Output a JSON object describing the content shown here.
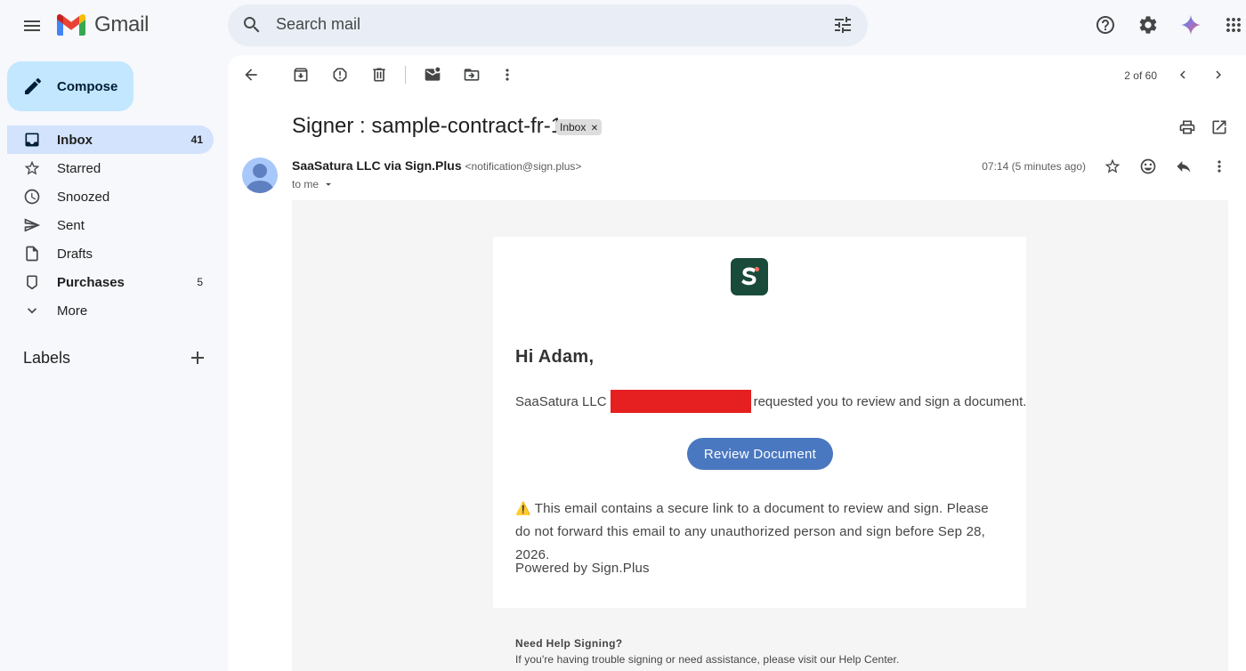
{
  "app": {
    "name": "Gmail"
  },
  "search": {
    "placeholder": "Search mail"
  },
  "sidebar": {
    "compose_label": "Compose",
    "items": [
      {
        "label": "Inbox",
        "count": "41"
      },
      {
        "label": "Starred",
        "count": ""
      },
      {
        "label": "Snoozed",
        "count": ""
      },
      {
        "label": "Sent",
        "count": ""
      },
      {
        "label": "Drafts",
        "count": ""
      },
      {
        "label": "Purchases",
        "count": "5"
      },
      {
        "label": "More",
        "count": ""
      }
    ],
    "labels_heading": "Labels"
  },
  "toolbar": {
    "pager": "2 of 60"
  },
  "email": {
    "subject": "Signer : sample-contract-fr-1",
    "tag": "Inbox",
    "sender_name": "SaaSatura LLC via Sign.Plus",
    "sender_email": "<notification@sign.plus>",
    "to": "to me",
    "time": "07:14 (5 minutes ago)",
    "body": {
      "greeting": "Hi Adam,",
      "request_prefix": "SaaSatura LLC",
      "request_suffix": "requested you to review and sign a document.",
      "button": "Review Document",
      "warning_icon": "⚠️",
      "warning": "This email contains a secure link to a document to review and sign. Please do not forward this email to any unauthorized person and sign before Sep 28, 2026.",
      "powered_by": "Powered by Sign.Plus",
      "help_title": "Need Help Signing?",
      "help_text_prefix": "If you're having trouble signing or need assistance, please visit",
      "help_link": "our Help Center",
      "help_text_suffix": "."
    }
  },
  "colors": {
    "compose_bg": "#c2e7ff",
    "active_nav_bg": "#d3e3fd",
    "review_button": "#4a78c0",
    "redaction": "#e62020"
  }
}
